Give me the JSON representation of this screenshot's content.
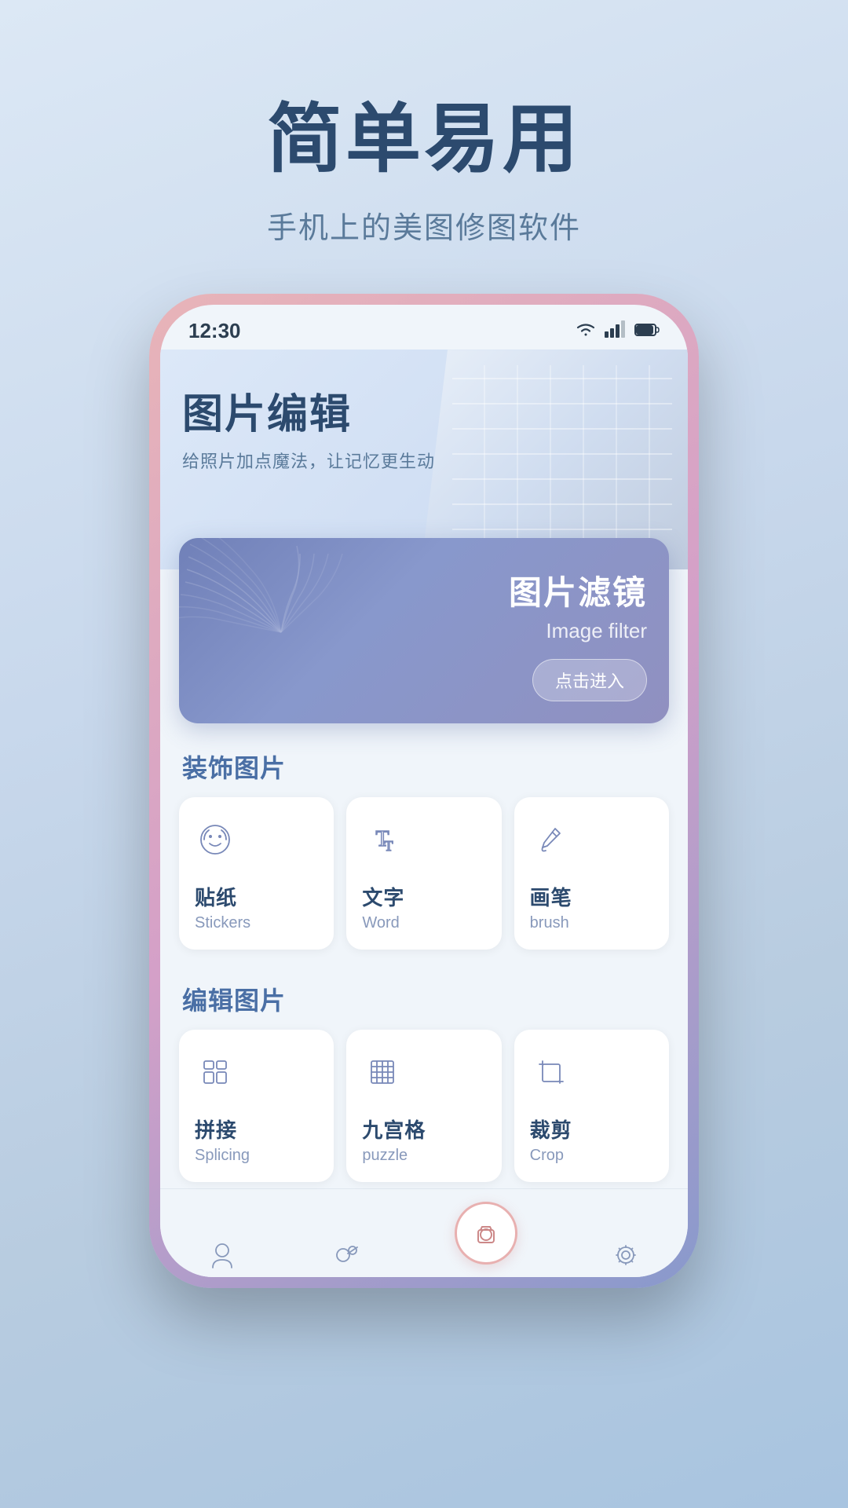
{
  "hero": {
    "title": "简单易用",
    "subtitle": "手机上的美图修图软件"
  },
  "phone": {
    "status_bar": {
      "time": "12:30"
    },
    "banner": {
      "title": "图片编辑",
      "desc": "给照片加点魔法，让记忆更生动"
    },
    "filter_card": {
      "title": "图片滤镜",
      "subtitle": "Image filter",
      "btn": "点击进入"
    },
    "decorate_section": {
      "title_prefix": "装饰",
      "title_suffix": "图片",
      "items": [
        {
          "icon": "sticker",
          "name_zh": "贴纸",
          "name_en": "Stickers"
        },
        {
          "icon": "text",
          "name_zh": "文字",
          "name_en": "Word"
        },
        {
          "icon": "brush",
          "name_zh": "画笔",
          "name_en": "brush"
        }
      ]
    },
    "edit_section": {
      "title_prefix": "编辑",
      "title_suffix": "图片",
      "items": [
        {
          "icon": "splice",
          "name_zh": "拼接",
          "name_en": "Splicing"
        },
        {
          "icon": "puzzle",
          "name_zh": "九宫格",
          "name_en": "puzzle"
        },
        {
          "icon": "crop",
          "name_zh": "裁剪",
          "name_en": "Crop"
        }
      ]
    }
  }
}
